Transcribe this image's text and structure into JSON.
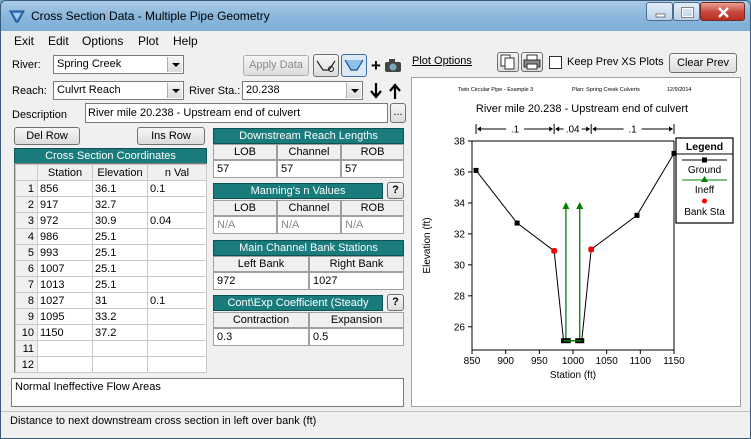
{
  "window": {
    "title": "Cross Section Data - Multiple Pipe Geometry"
  },
  "menu": [
    "Exit",
    "Edit",
    "Options",
    "Plot",
    "Help"
  ],
  "river": {
    "label": "River:",
    "value": "Spring Creek"
  },
  "reach": {
    "label": "Reach:",
    "value": "Culvrt Reach"
  },
  "river_sta": {
    "label": "River Sta.:",
    "value": "20.238"
  },
  "apply_data": "Apply Data",
  "description": {
    "label": "Description",
    "value": "River mile 20.238 - Upstream end of culvert",
    "more": "..."
  },
  "buttons": {
    "del_row": "Del Row",
    "ins_row": "Ins Row"
  },
  "coords": {
    "title": "Cross Section Coordinates",
    "headers": [
      "Station",
      "Elevation",
      "n Val"
    ],
    "rows": [
      {
        "n": "1",
        "sta": "856",
        "elev": "36.1",
        "nval": "0.1"
      },
      {
        "n": "2",
        "sta": "917",
        "elev": "32.7",
        "nval": ""
      },
      {
        "n": "3",
        "sta": "972",
        "elev": "30.9",
        "nval": "0.04"
      },
      {
        "n": "4",
        "sta": "986",
        "elev": "25.1",
        "nval": ""
      },
      {
        "n": "5",
        "sta": "993",
        "elev": "25.1",
        "nval": ""
      },
      {
        "n": "6",
        "sta": "1007",
        "elev": "25.1",
        "nval": ""
      },
      {
        "n": "7",
        "sta": "1013",
        "elev": "25.1",
        "nval": ""
      },
      {
        "n": "8",
        "sta": "1027",
        "elev": "31",
        "nval": "0.1"
      },
      {
        "n": "9",
        "sta": "1095",
        "elev": "33.2",
        "nval": ""
      },
      {
        "n": "10",
        "sta": "1150",
        "elev": "37.2",
        "nval": ""
      },
      {
        "n": "11",
        "sta": "",
        "elev": "",
        "nval": ""
      },
      {
        "n": "12",
        "sta": "",
        "elev": "",
        "nval": ""
      }
    ]
  },
  "reach_lengths": {
    "title": "Downstream Reach Lengths",
    "headers": [
      "LOB",
      "Channel",
      "ROB"
    ],
    "values": [
      "57",
      "57",
      "57"
    ]
  },
  "mannings": {
    "title": "Manning's n Values",
    "headers": [
      "LOB",
      "Channel",
      "ROB"
    ],
    "values": [
      "N/A",
      "N/A",
      "N/A"
    ],
    "help": "?"
  },
  "bank_stations": {
    "title": "Main Channel Bank Stations",
    "headers": [
      "Left Bank",
      "Right Bank"
    ],
    "values": [
      "972",
      "1027"
    ]
  },
  "coefficients": {
    "title": "Cont\\Exp Coefficient (Steady",
    "headers": [
      "Contraction",
      "Expansion"
    ],
    "values": [
      "0.3",
      "0.5"
    ],
    "help": "?"
  },
  "note": "Normal Ineffective Flow Areas",
  "status": "Distance to next downstream cross section in left over bank (ft)",
  "plot_options": "Plot Options",
  "keep_prev": "Keep Prev XS Plots",
  "clear_prev": "Clear Prev",
  "plot": {
    "header_left": "Twin Circular Pipe - Example 3",
    "header_mid": "Plan: Spring Creek Culverts",
    "header_right": "12/9/2014",
    "title": "River mile 20.238 - Upstream end of culvert",
    "n_labels": [
      ".1",
      ".04",
      ".1"
    ],
    "legend_title": "Legend",
    "legend": [
      "Ground",
      "Ineff",
      "Bank Sta"
    ]
  },
  "chart_data": {
    "type": "line",
    "xlabel": "Station (ft)",
    "ylabel": "Elevation (ft)",
    "xlim": [
      850,
      1150
    ],
    "ylim": [
      24.5,
      38
    ],
    "xticks": [
      850,
      900,
      950,
      1000,
      1050,
      1100,
      1150
    ],
    "yticks": [
      26,
      28,
      30,
      32,
      34,
      36,
      38
    ],
    "series": [
      {
        "name": "Ground",
        "color": "#000000",
        "x": [
          856,
          917,
          972,
          986,
          993,
          1007,
          1013,
          1027,
          1095,
          1150
        ],
        "y": [
          36.1,
          32.7,
          30.9,
          25.1,
          25.1,
          25.1,
          25.1,
          31,
          33.2,
          37.2
        ]
      },
      {
        "name": "Ineff",
        "color": "#008000",
        "x": [
          986,
          993,
          1007,
          1013
        ],
        "y": [
          33.8,
          33.8,
          33.8,
          33.8
        ]
      },
      {
        "name": "Bank Sta",
        "color": "#ff0000",
        "x": [
          972,
          1027
        ],
        "y": [
          30.9,
          31
        ]
      }
    ],
    "n_breaks": [
      972,
      1027
    ]
  }
}
